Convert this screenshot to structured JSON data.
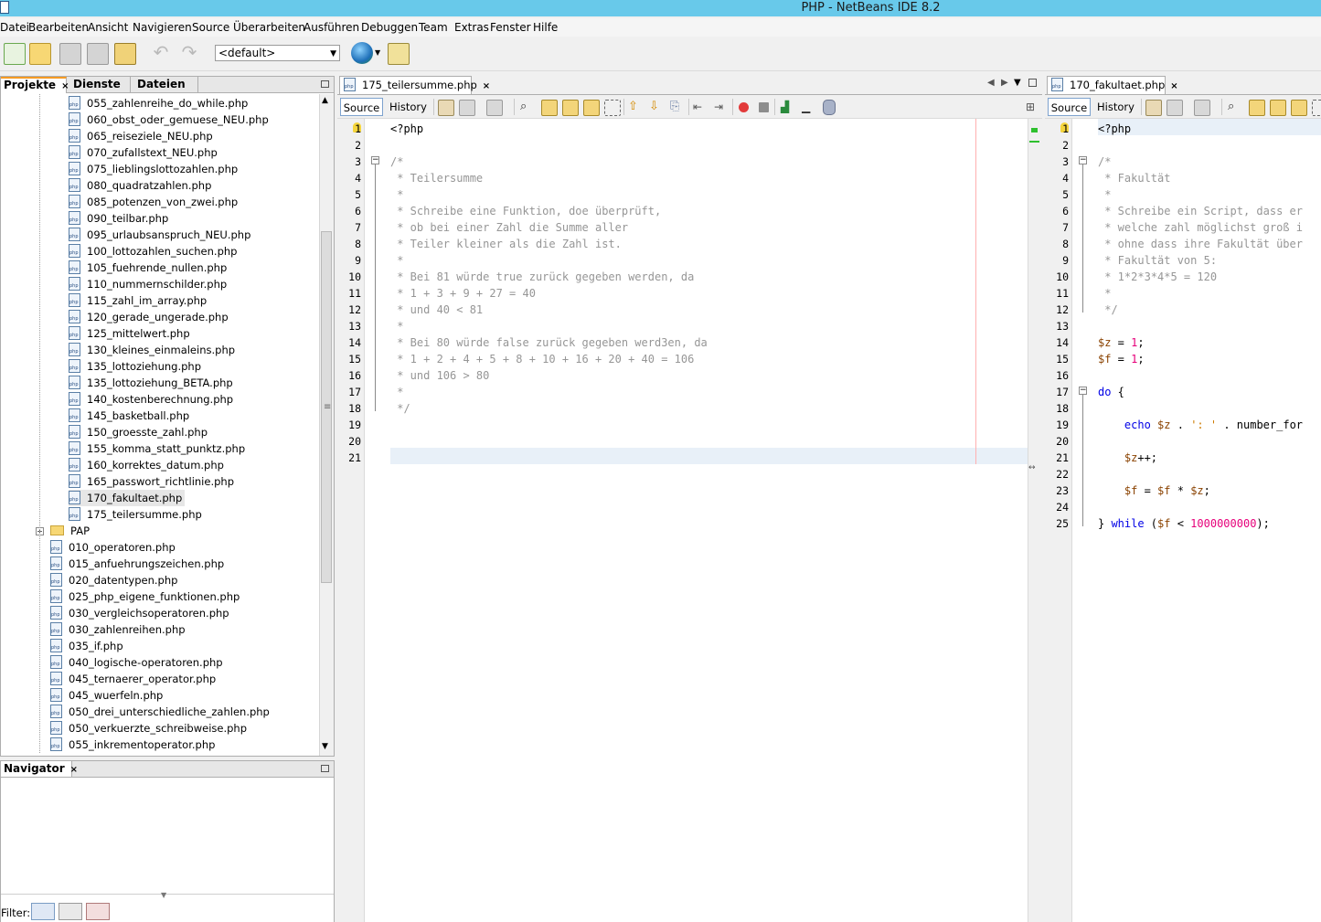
{
  "window": {
    "title": "PHP - NetBeans IDE 8.2"
  },
  "menu": [
    "Datei",
    "Bearbeiten",
    "Ansicht",
    "Navigieren",
    "Source",
    "Überarbeiten",
    "Ausführen",
    "Debuggen",
    "Team",
    "Extras",
    "Fenster",
    "Hilfe"
  ],
  "toolbar": {
    "config_value": "<default>"
  },
  "projects_panel": {
    "tabs": [
      "Projekte",
      "Dienste",
      "Dateien"
    ],
    "items": [
      "055_zahlenreihe_do_while.php",
      "060_obst_oder_gemuese_NEU.php",
      "065_reiseziele_NEU.php",
      "070_zufallstext_NEU.php",
      "075_lieblingslottozahlen.php",
      "080_quadratzahlen.php",
      "085_potenzen_von_zwei.php",
      "090_teilbar.php",
      "095_urlaubsanspruch_NEU.php",
      "100_lottozahlen_suchen.php",
      "105_fuehrende_nullen.php",
      "110_nummernschilder.php",
      "115_zahl_im_array.php",
      "120_gerade_ungerade.php",
      "125_mittelwert.php",
      "130_kleines_einmaleins.php",
      "135_lottoziehung.php",
      "135_lottoziehung_BETA.php",
      "140_kostenberechnung.php",
      "145_basketball.php",
      "150_groesste_zahl.php",
      "155_komma_statt_punktz.php",
      "160_korrektes_datum.php",
      "165_passwort_richtlinie.php",
      "170_fakultaet.php",
      "175_teilersumme.php"
    ],
    "folder": "PAP",
    "pap_items": [
      "010_operatoren.php",
      "015_anfuehrungszeichen.php",
      "020_datentypen.php",
      "025_php_eigene_funktionen.php",
      "030_vergleichsoperatoren.php",
      "030_zahlenreihen.php",
      "035_if.php",
      "040_logische-operatoren.php",
      "045_ternaerer_operator.php",
      "045_wuerfeln.php",
      "050_drei_unterschiedliche_zahlen.php",
      "050_verkuerzte_schreibweise.php",
      "055_inkrementoperator.php"
    ]
  },
  "navigator": {
    "title": "Navigator",
    "filter_label": "Filter:"
  },
  "editor1": {
    "tab": "175_teilersumme.php",
    "subtabs": [
      "Source",
      "History"
    ],
    "line_numbers": [
      "1",
      "2",
      "3",
      "4",
      "5",
      "6",
      "7",
      "8",
      "9",
      "10",
      "11",
      "12",
      "13",
      "14",
      "15",
      "16",
      "17",
      "18",
      "19",
      "20",
      "21"
    ],
    "lines": [
      "<?php",
      "",
      "/*",
      " * Teilersumme",
      " *",
      " * Schreibe eine Funktion, doe überprüft,",
      " * ob bei einer Zahl die Summe aller",
      " * Teiler kleiner als die Zahl ist.",
      " *",
      " * Bei 81 würde true zurück gegeben werden, da",
      " * 1 + 3 + 9 + 27 = 40",
      " * und 40 < 81",
      " *",
      " * Bei 80 würde false zurück gegeben werd3en, da",
      " * 1 + 2 + 4 + 5 + 8 + 10 + 16 + 20 + 40 = 106",
      " * und 106 > 80",
      " *",
      " */",
      "",
      "",
      ""
    ]
  },
  "editor2": {
    "tab": "170_fakultaet.php",
    "subtabs": [
      "Source",
      "History"
    ],
    "line_numbers": [
      "1",
      "2",
      "3",
      "4",
      "5",
      "6",
      "7",
      "8",
      "9",
      "10",
      "11",
      "12",
      "13",
      "14",
      "15",
      "16",
      "17",
      "18",
      "19",
      "20",
      "21",
      "22",
      "23",
      "24",
      "25"
    ],
    "lines": [
      "<?php",
      "",
      "/*",
      " * Fakultät",
      " *",
      " * Schreibe ein Script, dass er",
      " * welche zahl möglichst groß i",
      " * ohne dass ihre Fakultät über",
      " * Fakultät von 5:",
      " * 1*2*3*4*5 = 120",
      " *",
      " */",
      "",
      "$z = 1;",
      "$f = 1;",
      "",
      "do {",
      "",
      "    echo $z . ': ' . number_for",
      "",
      "    $z++;",
      "",
      "    $f = $f * $z;",
      "",
      "} while ($f < 1000000000);"
    ]
  }
}
